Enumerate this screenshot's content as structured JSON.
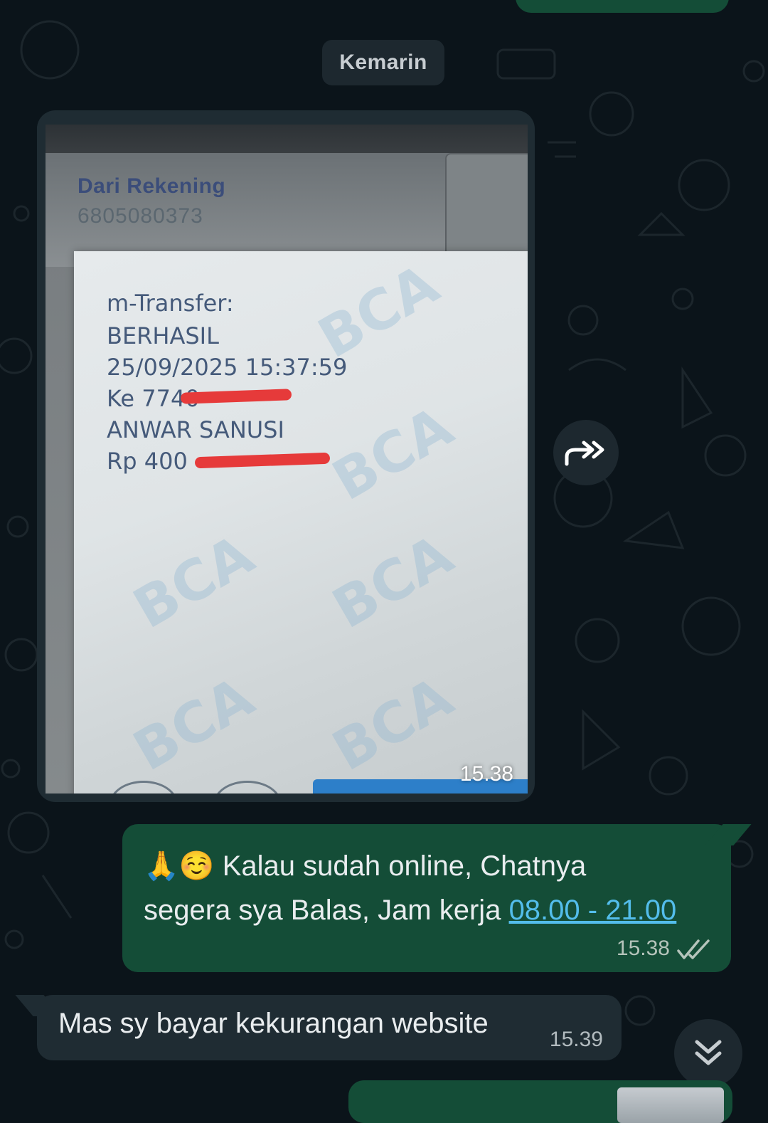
{
  "colors": {
    "background": "#0b141a",
    "incoming_bubble": "#1f2c33",
    "outgoing_bubble": "#144d37",
    "link": "#53bdeb",
    "text": "#e9edef"
  },
  "date_separator": "Kemarin",
  "image_message": {
    "photo_content": {
      "source_label": "Dari Rekening",
      "source_account": "6805080373",
      "receipt_lines": [
        "m-Transfer:",
        "BERHASIL",
        "25/09/2025 15:37:59",
        "Ke 7740",
        "ANWAR SANUSI",
        "Rp 400"
      ],
      "watermark": "BCA"
    },
    "time": "15.38",
    "forward_icon": "forward-arrow-icon"
  },
  "outgoing_message": {
    "emoji_1": "🙏",
    "emoji_2": "☺️",
    "line_1": " Kalau sudah online, Chatnya",
    "line_2_prefix": "segera sya Balas, Jam kerja ",
    "link_text": "08.00 - 21.00",
    "time": "15.38",
    "status_icon": "double-check-icon"
  },
  "incoming_message": {
    "text": "Mas sy bayar kekurangan website",
    "time": "15.39"
  },
  "scroll_button_icon": "double-chevron-down-icon"
}
